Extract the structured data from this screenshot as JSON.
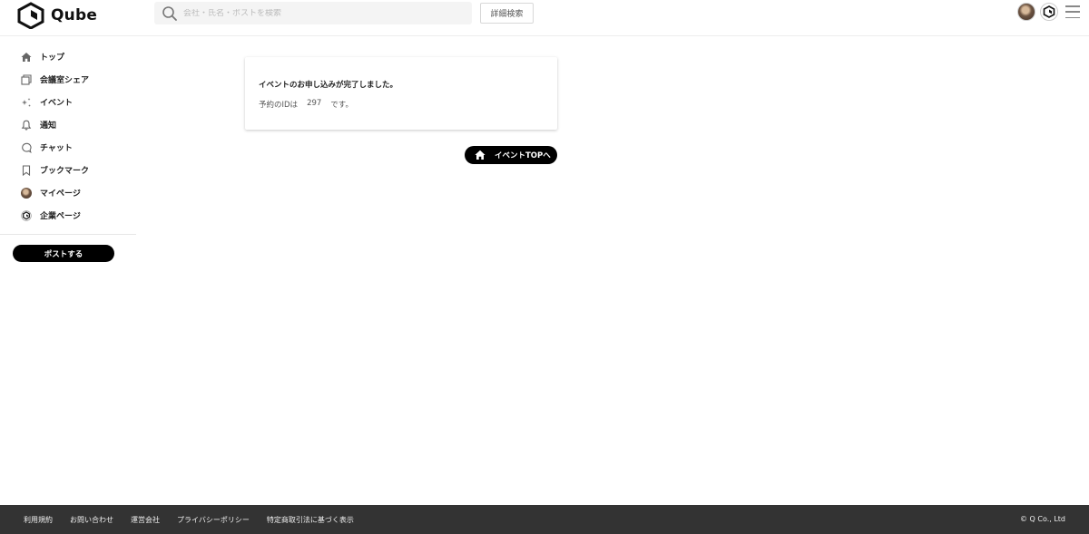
{
  "header": {
    "brand": "Qube",
    "search_placeholder": "会社・氏名・ポストを検索",
    "advanced_search_label": "詳細検索",
    "user_avatar_icon": "user-avatar",
    "company_avatar_icon": "company-logo-icon",
    "menu_icon": "hamburger-menu-icon"
  },
  "sidebar": {
    "items": [
      {
        "label": "トップ",
        "icon": "home-icon"
      },
      {
        "label": "会議室シェア",
        "icon": "copy-icon"
      },
      {
        "label": "イベント",
        "icon": "sparkle-icon"
      },
      {
        "label": "通知",
        "icon": "bell-icon"
      },
      {
        "label": "チャット",
        "icon": "chat-bubble-icon"
      },
      {
        "label": "ブックマーク",
        "icon": "bookmark-icon"
      },
      {
        "label": "マイページ",
        "icon": "user-avatar"
      },
      {
        "label": "企業ページ",
        "icon": "company-logo-icon"
      }
    ],
    "post_button_label": "ポストする"
  },
  "main": {
    "card_title": "イベントのお申し込みが完了しました。",
    "reservation_prefix": "予約のIDは",
    "reservation_id": "297",
    "reservation_suffix": "です。",
    "event_top_button_label": "イベントTOPへ"
  },
  "footer": {
    "links": [
      "利用規約",
      "お問い合わせ",
      "運営会社",
      "プライバシーポリシー",
      "特定商取引法に基づく表示"
    ],
    "copyright": "© Q Co., Ltd"
  },
  "colors": {
    "primary": "#000000",
    "footer_bg": "#333333",
    "search_bg": "#f4f4f4"
  }
}
